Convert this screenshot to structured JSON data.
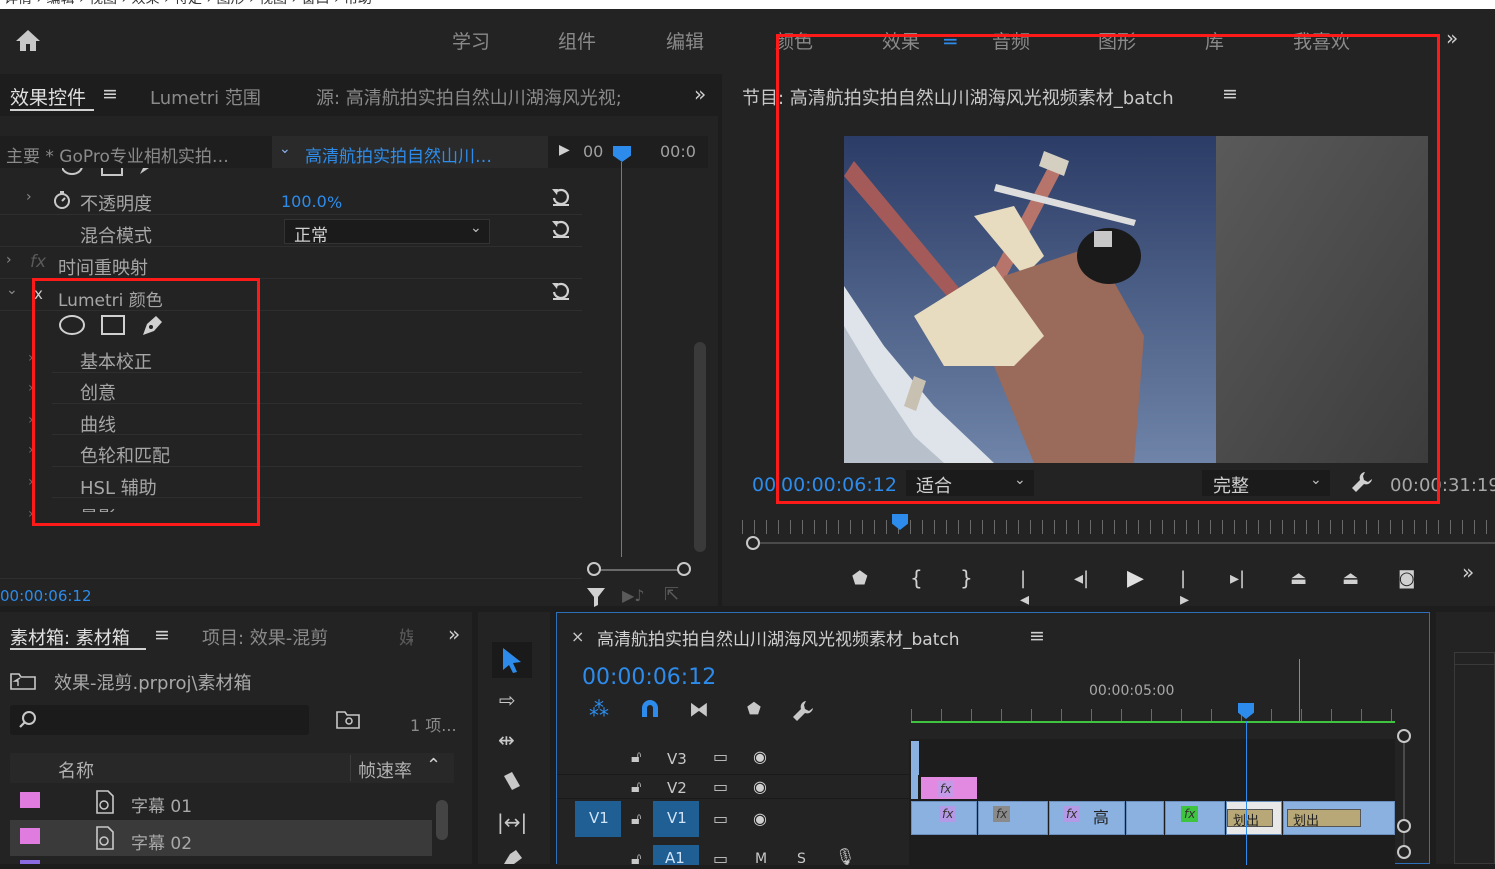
{
  "breadcrumb_top": "详情 › 编辑 › 视图 › 效果 › 特定 › 图形 › 视图 › 窗口 › 帮助",
  "workspaces": [
    "学习",
    "组件",
    "编辑",
    "颜色",
    "效果",
    "音频",
    "图形",
    "库",
    "我喜欢"
  ],
  "active_workspace": "效果",
  "effect_controls": {
    "tabs": [
      "效果控件",
      "Lumetri 范围",
      "源: 高清航拍实拍自然山川湖海风光视;"
    ],
    "master_label": "主要 * GoPro专业相机实拍…",
    "clip_label": "高清航拍实拍自然山川…",
    "ruler_left": "00",
    "ruler_right": "00:0",
    "opacity_label": "不透明度",
    "opacity_value": "100.0",
    "opacity_unit": "%",
    "blend_label": "混合模式",
    "blend_value": "正常",
    "time_remap": "时间重映射",
    "lumetri_label": "Lumetri 颜色",
    "lumetri_sections": [
      "基本校正",
      "创意",
      "曲线",
      "色轮和匹配",
      "HSL 辅助",
      "晕影"
    ],
    "timecode": "00:00:06:12"
  },
  "program": {
    "title": "节目: 高清航拍实拍自然山川湖海风光视频素材_batch",
    "timecode": "00:00:06:12",
    "timecode_prefix": "00",
    "fit": "适合",
    "quality": "完整",
    "duration": "00:00:31:19"
  },
  "bin": {
    "tabs": [
      "素材箱: 素材箱",
      "项目: 效果-混剪",
      "媒"
    ],
    "path": "效果-混剪.prproj\\素材箱",
    "count": "1 项...",
    "col_name": "名称",
    "col_fps": "帧速率",
    "items": [
      {
        "name": "字幕 01",
        "color": "#e07be0"
      },
      {
        "name": "字幕 02",
        "color": "#e07be0"
      }
    ]
  },
  "timeline": {
    "title": "高清航拍实拍自然山川湖海风光视频素材_batch",
    "timecode": "00:00:06:12",
    "ruler_label": "00:00:05:00",
    "tracks": [
      "V3",
      "V2",
      "V1",
      "A1"
    ],
    "source_patch": "V1",
    "clip_text_1": "高",
    "transition_1": "划出",
    "transition_2": "划出",
    "audio_m": "M",
    "audio_s": "S"
  },
  "colors": {
    "accent_blue": "#2d8ceb",
    "highlight_red": "#ff1a1a",
    "clip_blue": "#8ab1e0",
    "fx_purple": "#b499e6",
    "track_green": "#3fc43f"
  }
}
